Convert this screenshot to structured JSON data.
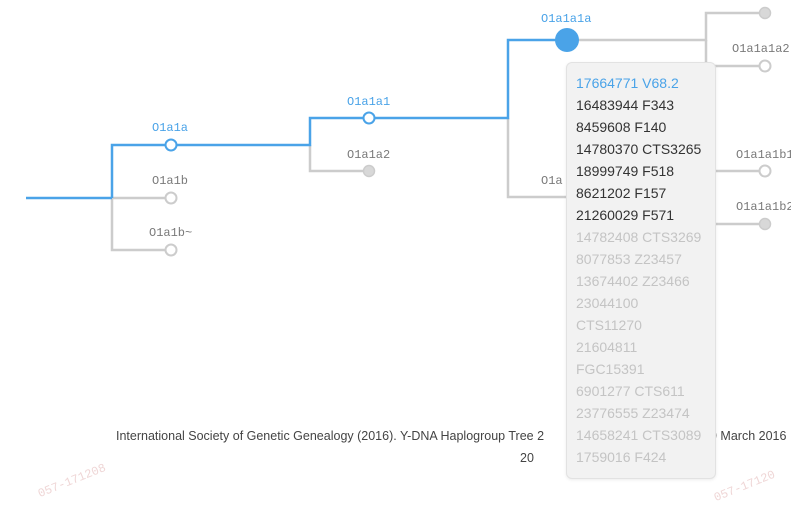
{
  "tree": {
    "labels": {
      "o1a1a": "O1a1a",
      "o1a1b": "O1a1b",
      "o1a1b_tilde": "O1a1b~",
      "o1a1a1": "O1a1a1",
      "o1a1a2": "O1a1a2",
      "o1a1a1a": "O1a1a1a",
      "o1a1a1a2": "O1a1a1a2",
      "o1a1a1b_partial": "O1a",
      "o1a1a1b1": "O1a1a1b1",
      "o1a1a1b2": "O1a1a1b2"
    },
    "colors": {
      "active": "#4aa3e8",
      "inactive": "#cccccc",
      "node_fill_gray": "#d8d8d8"
    }
  },
  "popup": {
    "items": [
      {
        "text": "17664771 V68.2",
        "style": "primary"
      },
      {
        "text": "16483944 F343",
        "style": "normal"
      },
      {
        "text": "8459608 F140",
        "style": "normal"
      },
      {
        "text": "14780370 CTS3265",
        "style": "normal"
      },
      {
        "text": "18999749 F518",
        "style": "normal"
      },
      {
        "text": "8621202 F157",
        "style": "normal"
      },
      {
        "text": "21260029 F571",
        "style": "normal"
      },
      {
        "text": "14782408 CTS3269",
        "style": "muted"
      },
      {
        "text": "8077853 Z23457",
        "style": "muted"
      },
      {
        "text": "13674402 Z23466",
        "style": "muted"
      },
      {
        "text": "23044100",
        "style": "muted"
      },
      {
        "text": "CTS11270",
        "style": "muted"
      },
      {
        "text": "21604811",
        "style": "muted"
      },
      {
        "text": "FGC15391",
        "style": "muted"
      },
      {
        "text": "6901277 CTS611",
        "style": "muted"
      },
      {
        "text": "23776555 Z23474",
        "style": "muted"
      },
      {
        "text": "14658241 CTS3089",
        "style": "muted"
      },
      {
        "text": "1759016 F424",
        "style": "muted"
      }
    ]
  },
  "citation": {
    "line1": "International Society of Genetic Genealogy (2016). Y-DNA Haplogroup Tree 2",
    "line1_right": "9 March 2016",
    "line2": "20"
  },
  "watermarks": [
    "057-171208",
    "057-17120"
  ]
}
